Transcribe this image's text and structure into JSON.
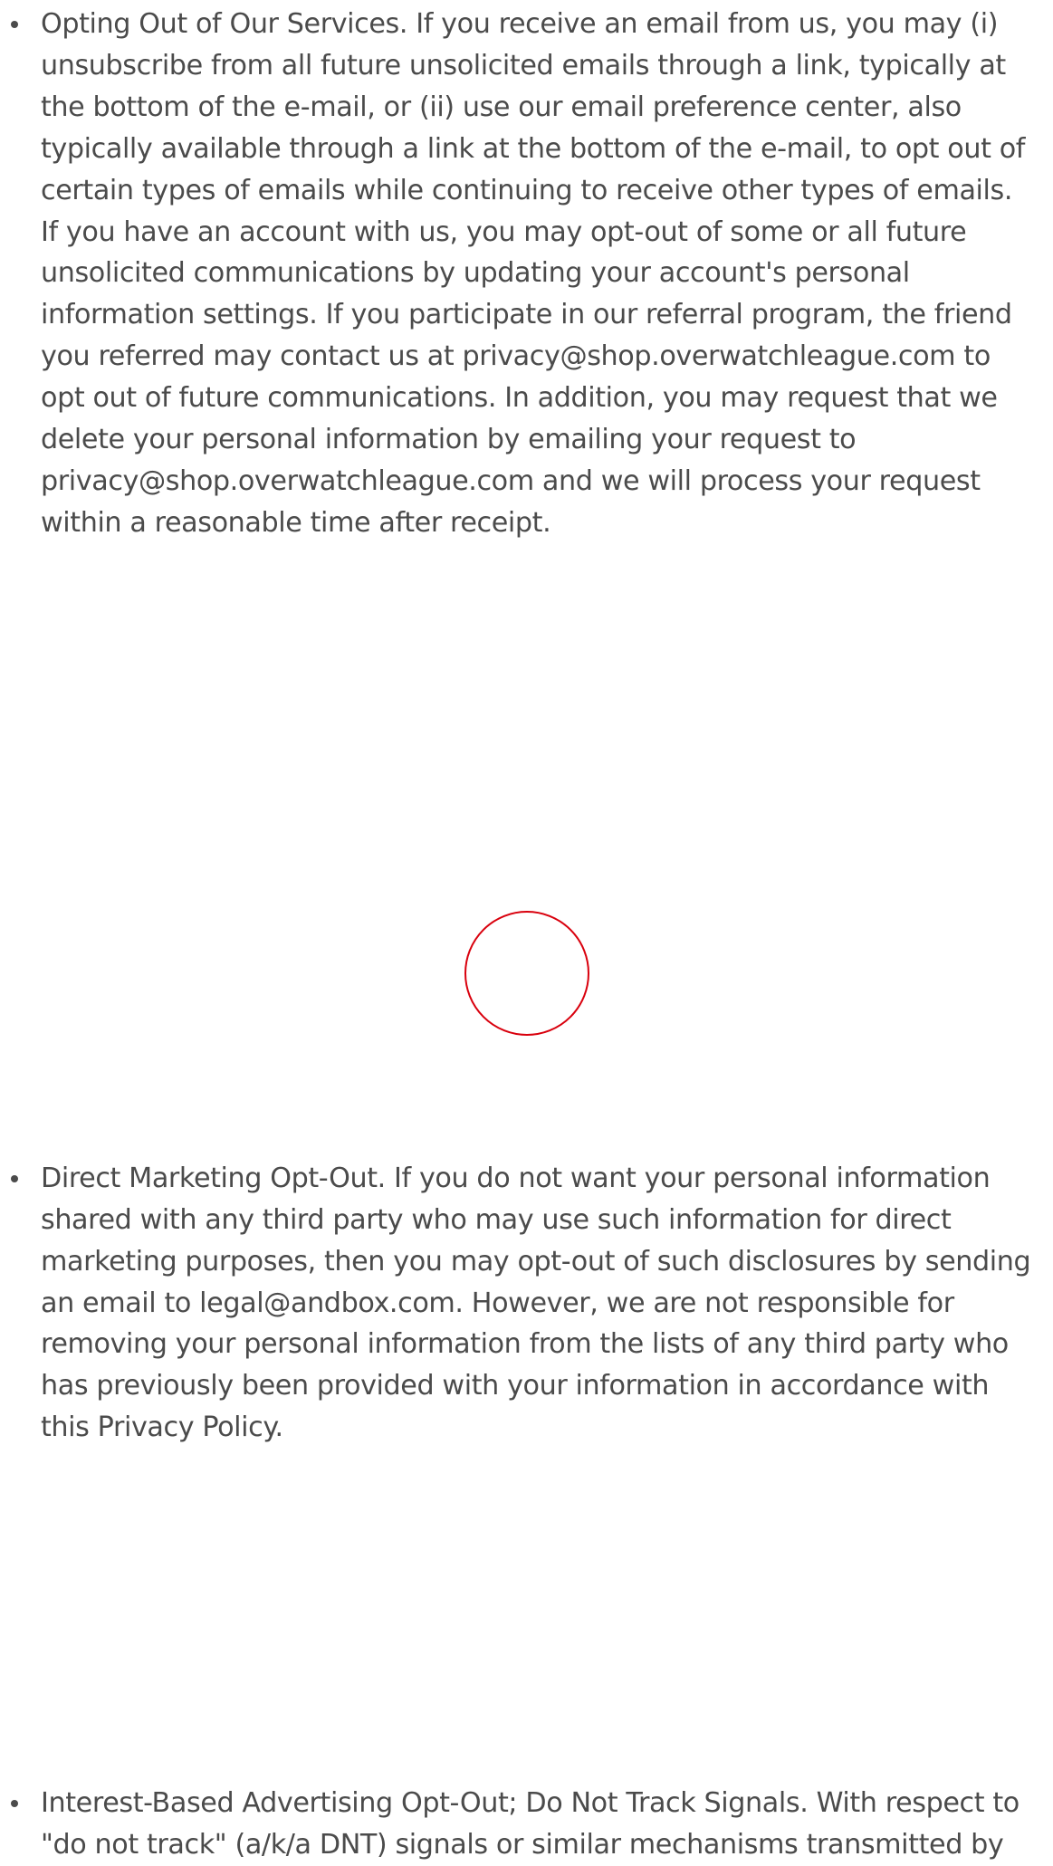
{
  "policy": {
    "items": [
      {
        "text": "Opting Out of Our Services. If you receive an email from us, you may (i) unsubscribe from all future unsolicited emails through a link, typically at the bottom of the e-mail, or (ii) use our email preference center, also typically available through a link at the bottom of the e-mail, to opt out of certain types of emails while continuing to receive other types of emails. If you have an account with us, you may opt-out of some or all future unsolicited communications by updating your account's personal information settings. If you participate in our referral program, the friend you referred may contact us at privacy@shop.overwatchleague.com to opt out of future communications. In addition, you may request that we delete your personal information by emailing your request to privacy@shop.overwatchleague.com and we will process your request within a reasonable time after receipt."
      },
      {
        "text": "Direct Marketing Opt-Out. If you do not want your personal information shared with any third party who may use such information for direct marketing purposes, then you may opt-out of such disclosures by sending an email to legal@andbox.com. However, we are not responsible for removing your personal information from the lists of any third party who has previously been provided with your information in accordance with this Privacy Policy."
      },
      {
        "text": "Interest-Based Advertising Opt-Out; Do Not Track Signals. With respect to \"do not track\" (a/k/a DNT) signals or similar mechanisms transmitted by"
      }
    ]
  },
  "overlay": {
    "indicator": "tap-indicator-circle",
    "color": "#d9000d"
  }
}
